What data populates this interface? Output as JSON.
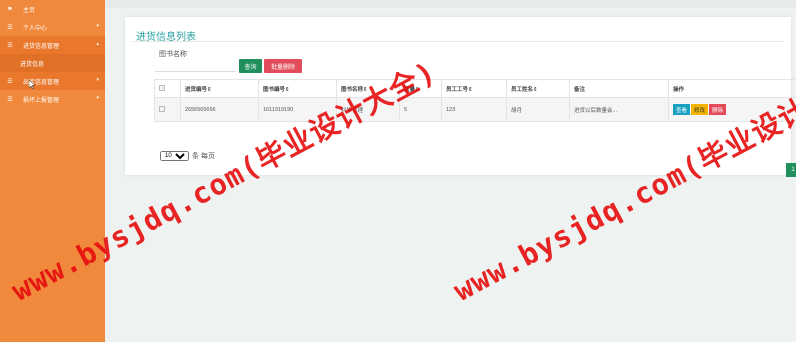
{
  "sidebar": {
    "items": [
      {
        "label": "主页",
        "icon": "flag-icon"
      },
      {
        "label": "个人中心",
        "icon": "list-icon"
      },
      {
        "label": "进货信息管理",
        "icon": "list-icon"
      },
      {
        "label": "进货信息",
        "sub": true
      },
      {
        "label": "出库信息管理",
        "icon": "list-icon"
      },
      {
        "label": "损坏上报管理",
        "icon": "list-icon"
      }
    ]
  },
  "panel": {
    "title": "进货信息列表",
    "search_label": "图书名称",
    "search_value": "",
    "query_label": "查询",
    "batch_delete_label": "批量删除"
  },
  "table": {
    "headers": [
      "进货编号",
      "图书编号",
      "图书名称",
      "数量",
      "员工工号",
      "员工姓名",
      "备注",
      "操作"
    ],
    "rows": [
      {
        "jinhuo_no": "2656565656",
        "book_no": "1611919190",
        "book_name": "科学管理",
        "qty": "5",
        "emp_no": "123",
        "emp_name": "胡月",
        "note": "进货以后数量会..."
      }
    ],
    "op_view": "查看",
    "op_edit": "修改",
    "op_delete": "删除"
  },
  "pager": {
    "page_size": "10",
    "per_page_label": "条 每页",
    "current_page": "1"
  },
  "watermark": {
    "text": "www.bysjdq.com(毕业设计大全)",
    "color": "#e50c0c"
  }
}
